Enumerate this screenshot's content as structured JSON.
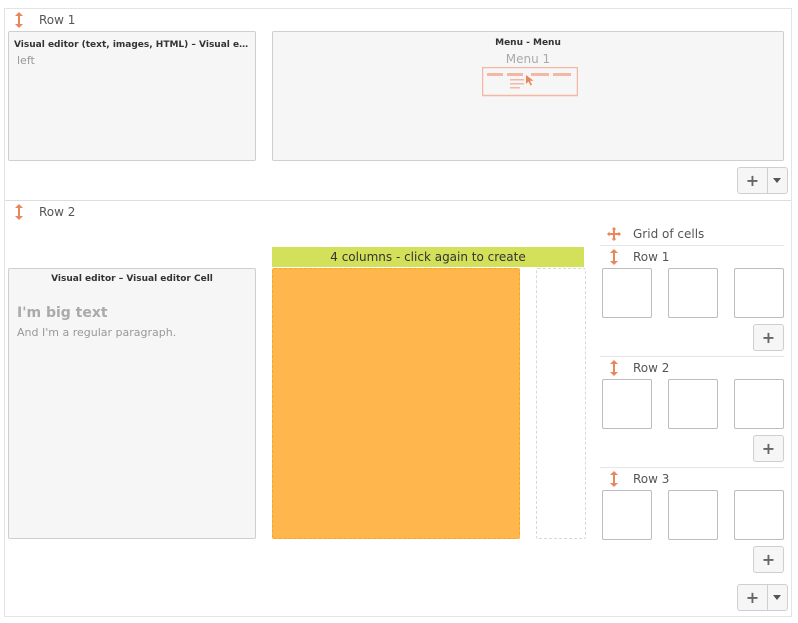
{
  "rows": [
    {
      "label": "Row 1",
      "cells": [
        {
          "title": "Visual editor (text, images, HTML) – Visual edito...",
          "content": "left"
        },
        {
          "title": "Menu - Menu",
          "content": "Menu 1"
        }
      ]
    },
    {
      "label": "Row 2",
      "cells": [
        {
          "title": "Visual editor – Visual editor Cell",
          "heading": "I'm big text",
          "paragraph": "And I'm a regular paragraph."
        }
      ],
      "column_banner": "4 columns - click again to create"
    }
  ],
  "grid": {
    "title": "Grid of cells",
    "rows": [
      {
        "label": "Row 1"
      },
      {
        "label": "Row 2"
      },
      {
        "label": "Row 3"
      }
    ]
  },
  "buttons": {
    "add_symbol": "+"
  },
  "colors": {
    "accent_arrow": "#e8875a",
    "banner": "#d3e15a",
    "column_fill": "#ffb64d",
    "menu_preview": "#f3b7a6"
  },
  "icons": {
    "row_handle": "vertical-resize-arrow-icon",
    "grid_move": "move-cross-icon",
    "menu_preview": "menu-preview-icon",
    "caret": "chevron-down-icon"
  }
}
